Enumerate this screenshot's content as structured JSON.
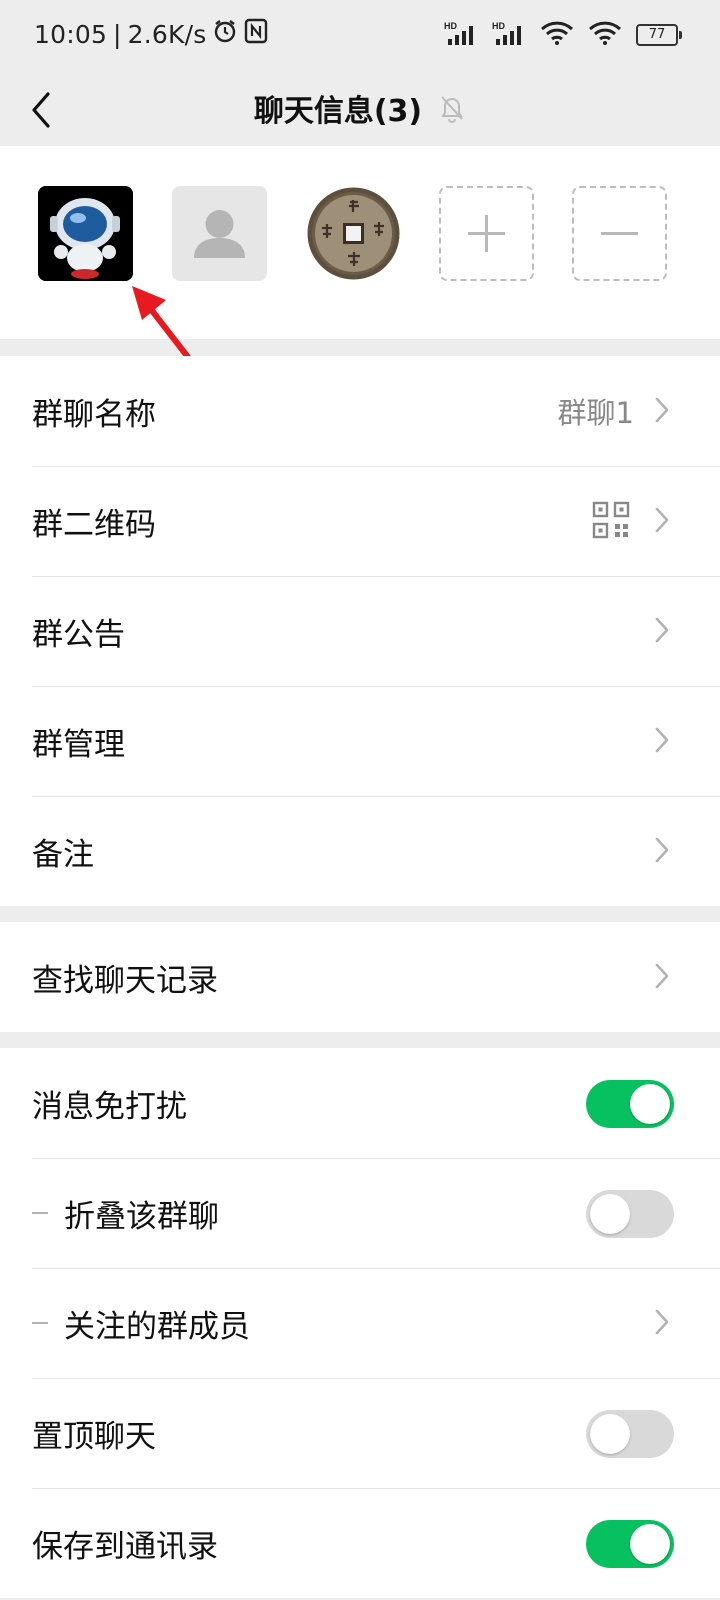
{
  "status_bar": {
    "time": "10:05",
    "network_speed": "2.6K/s",
    "battery": "77"
  },
  "nav": {
    "title": "聊天信息(3)"
  },
  "members": [
    {
      "name": "astronaut-avatar"
    },
    {
      "name": "default-avatar"
    },
    {
      "name": "coin-avatar"
    }
  ],
  "settings": {
    "group_name": {
      "label": "群聊名称",
      "value": "群聊1"
    },
    "group_qr": {
      "label": "群二维码"
    },
    "group_notice": {
      "label": "群公告"
    },
    "group_manage": {
      "label": "群管理"
    },
    "remark": {
      "label": "备注"
    },
    "search_history": {
      "label": "查找聊天记录"
    },
    "mute": {
      "label": "消息免打扰",
      "on": true
    },
    "fold": {
      "label": "折叠该群聊",
      "on": false
    },
    "followed_members": {
      "label": "关注的群成员"
    },
    "pin": {
      "label": "置顶聊天",
      "on": false
    },
    "save_contacts": {
      "label": "保存到通讯录",
      "on": true
    }
  },
  "colors": {
    "accent": "#07c160",
    "arrow": "#e8191f"
  }
}
